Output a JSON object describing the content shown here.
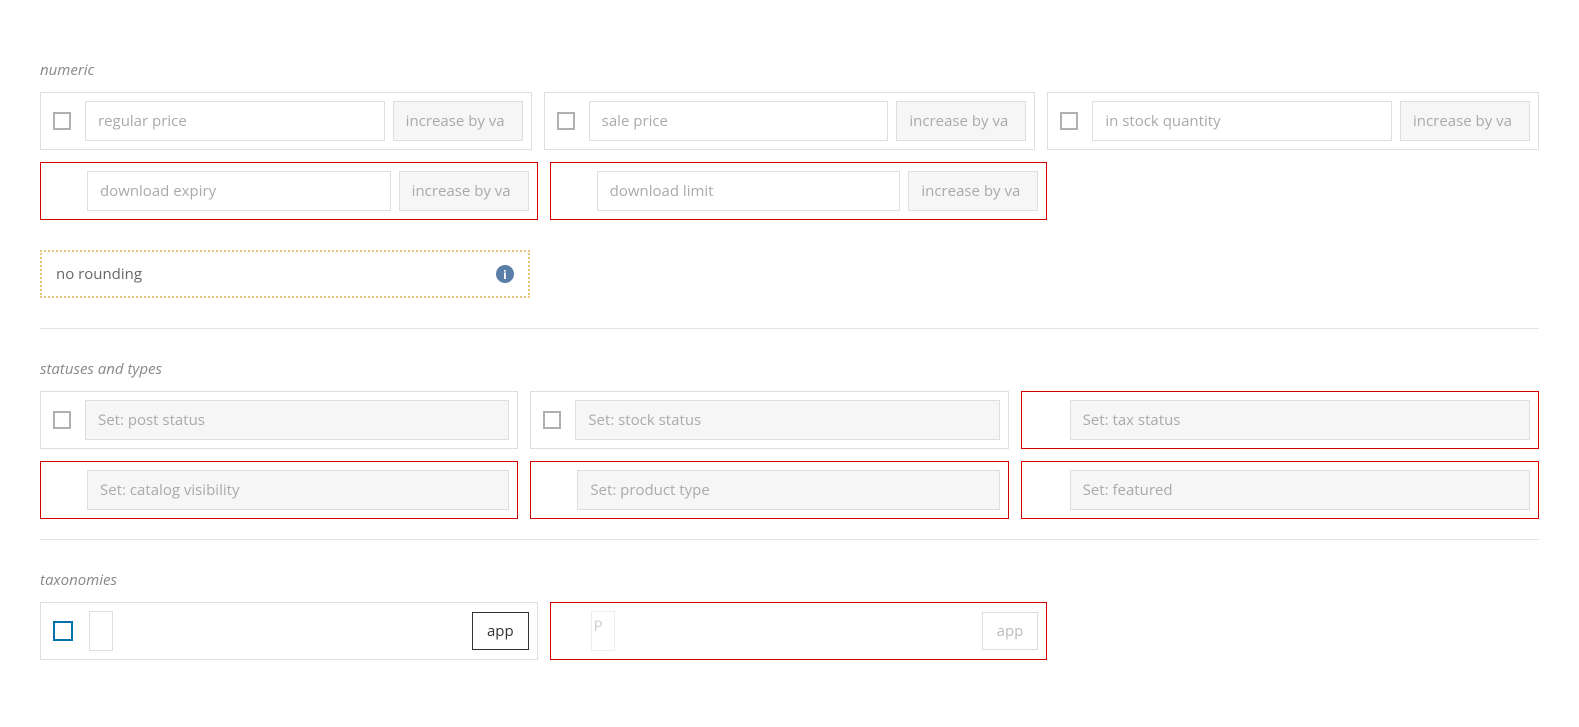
{
  "sections": {
    "numeric": {
      "title": "numeric",
      "fields": {
        "regular_price": {
          "label": "regular price",
          "action": "increase by va"
        },
        "sale_price": {
          "label": "sale price",
          "action": "increase by va"
        },
        "in_stock_quantity": {
          "label": "in stock quantity",
          "action": "increase by va"
        },
        "download_expiry": {
          "label": "download expiry",
          "action": "increase by va"
        },
        "download_limit": {
          "label": "download limit",
          "action": "increase by va"
        }
      },
      "no_rounding": "no rounding"
    },
    "statuses": {
      "title": "statuses and types",
      "fields": {
        "post_status": "Set: post status",
        "stock_status": "Set: stock status",
        "tax_status": "Set: tax status",
        "catalog_visibility": "Set: catalog visibility",
        "product_type": "Set: product type",
        "featured": "Set: featured"
      }
    },
    "taxonomies": {
      "title": "taxonomies",
      "app_button": "app",
      "placeholder_char": "P"
    }
  }
}
